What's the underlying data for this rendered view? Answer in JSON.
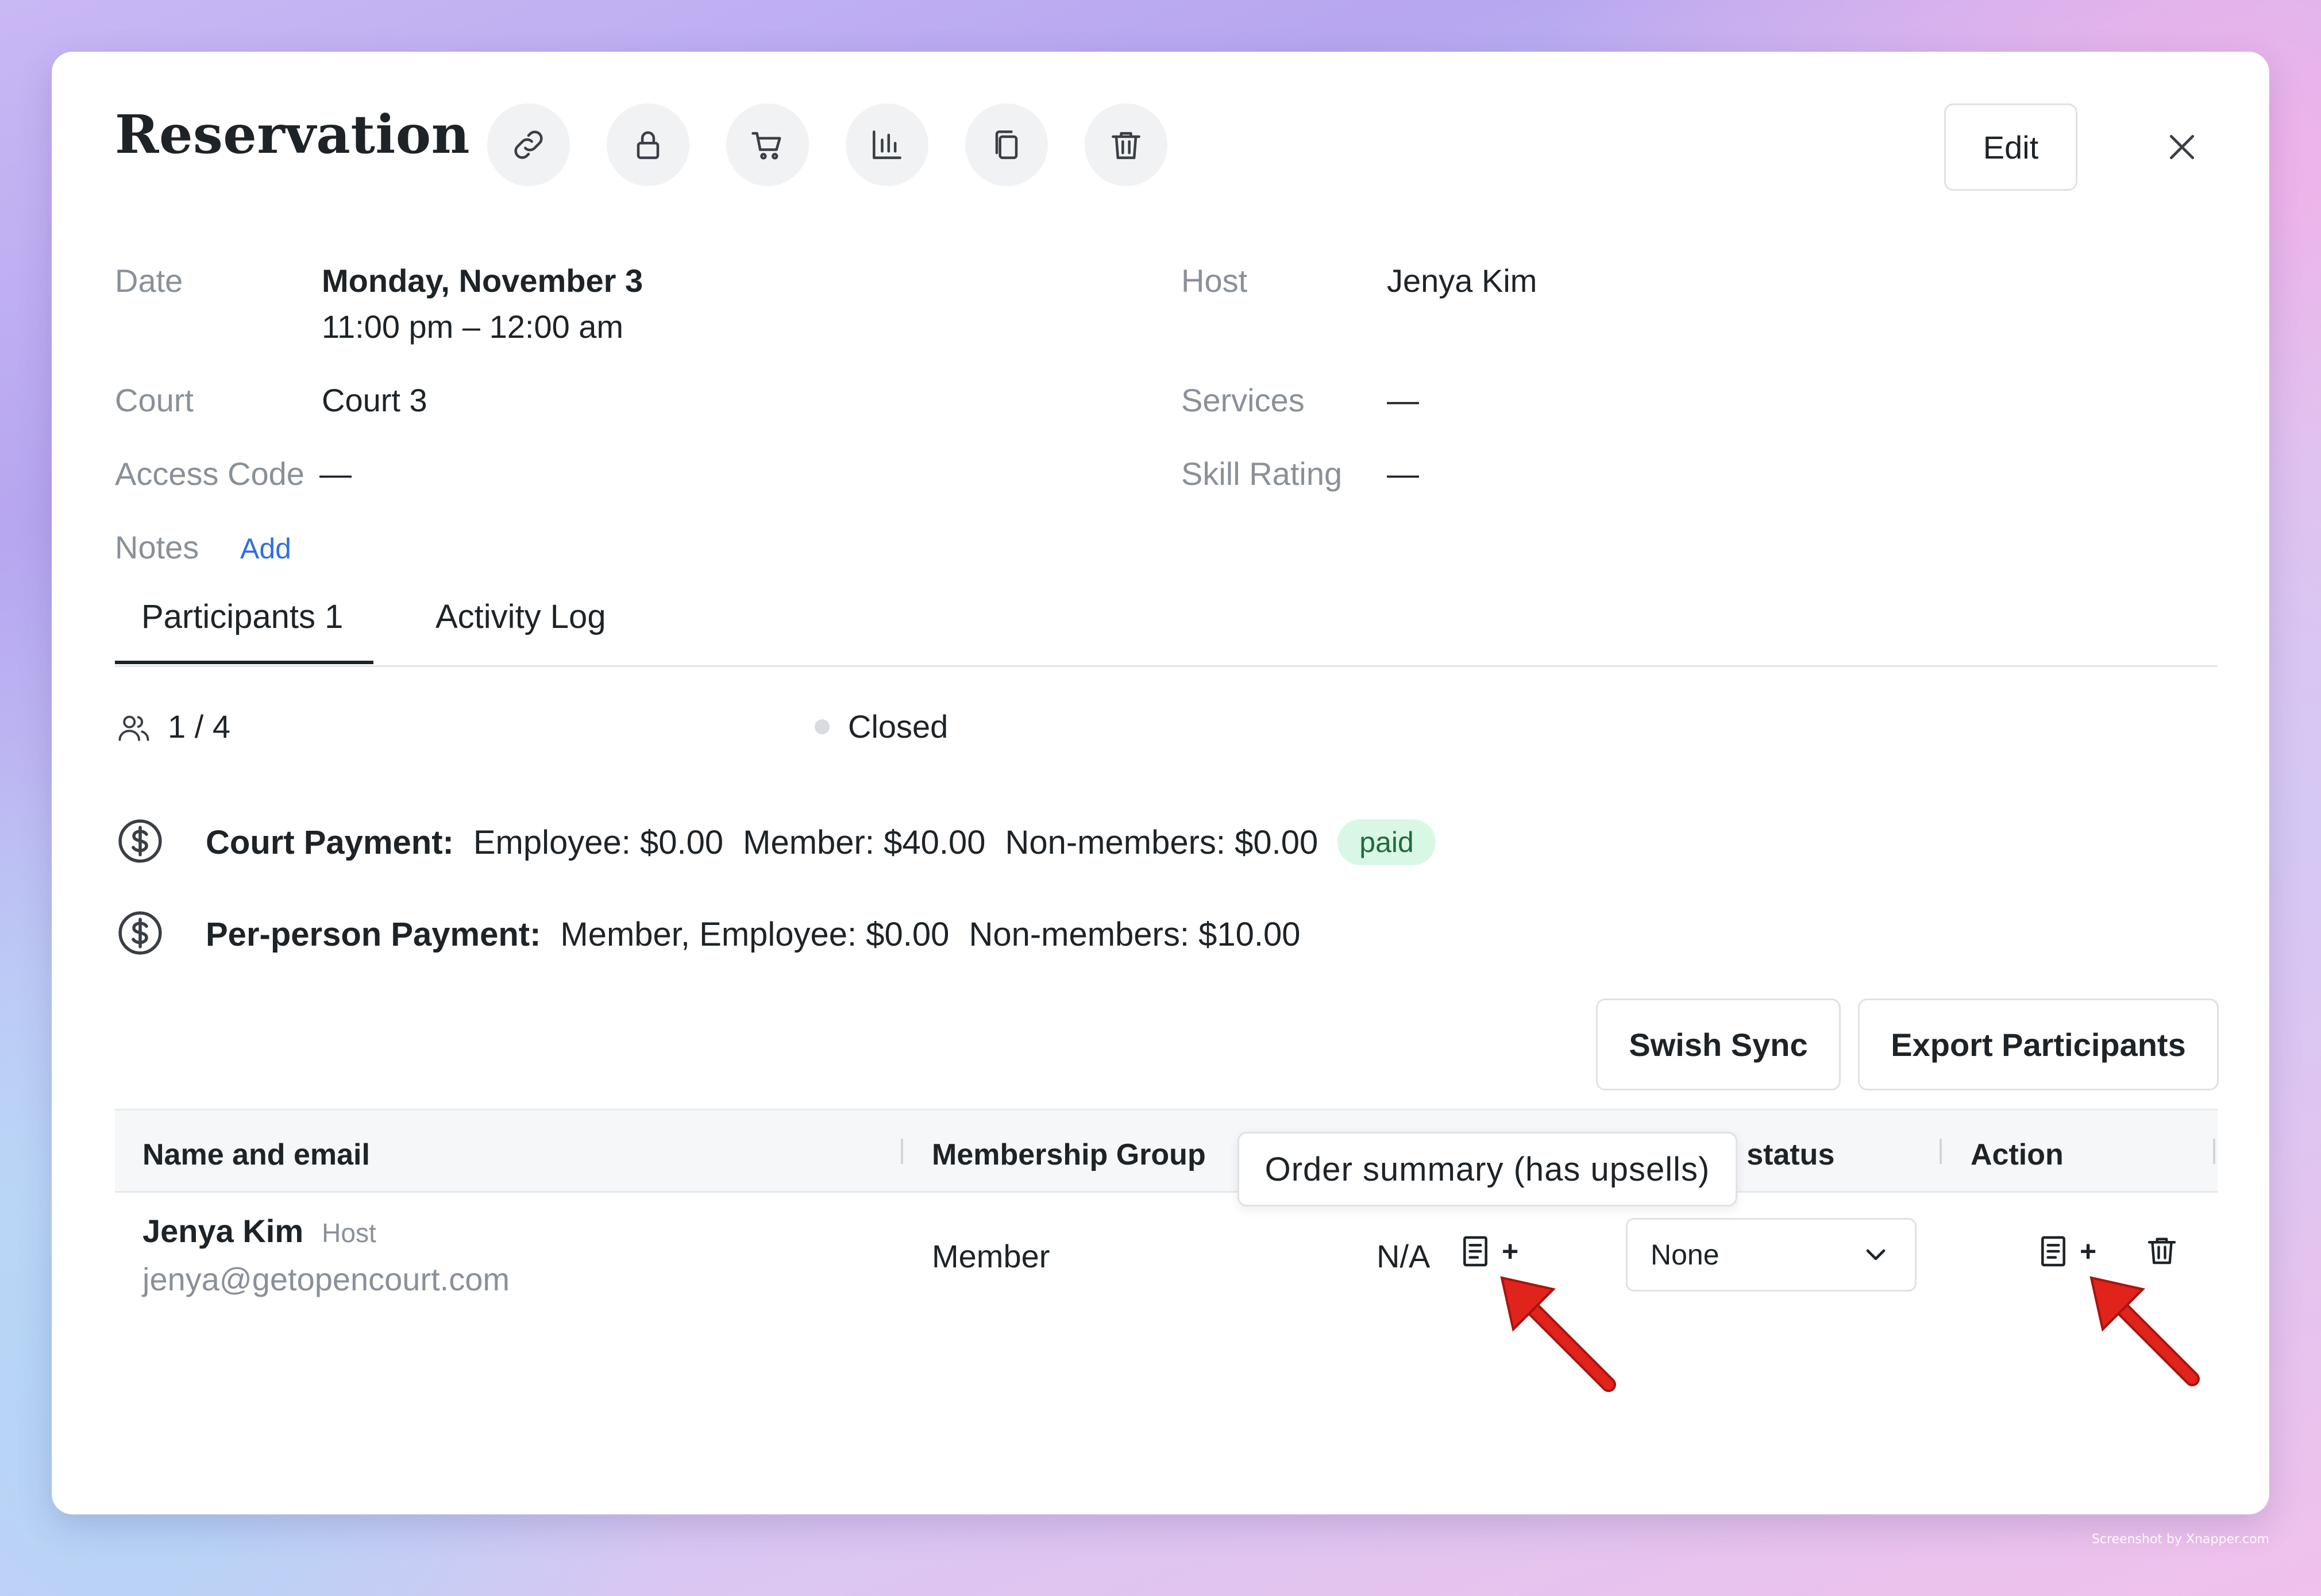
{
  "header": {
    "title": "Reservation",
    "icons": [
      "link-icon",
      "lock-icon",
      "cart-icon",
      "chart-icon",
      "copy-icon",
      "trash-icon"
    ],
    "edit_label": "Edit"
  },
  "details": {
    "date_label": "Date",
    "date_value": "Monday, November 3",
    "time_value": "11:00 pm – 12:00 am",
    "court_label": "Court",
    "court_value": "Court 3",
    "access_code_label": "Access Code",
    "access_code_value": "—",
    "notes_label": "Notes",
    "notes_add": "Add",
    "host_label": "Host",
    "host_value": "Jenya Kim",
    "services_label": "Services",
    "services_value": "—",
    "skill_label": "Skill Rating",
    "skill_value": "—"
  },
  "tabs": [
    {
      "label": "Participants 1",
      "active": true
    },
    {
      "label": "Activity Log",
      "active": false
    }
  ],
  "summary": {
    "count": "1 / 4",
    "status": "Closed"
  },
  "payments": {
    "court_label": "Court Payment:",
    "court_employee": "Employee: $0.00",
    "court_member": "Member: $40.00",
    "court_nonmember": "Non-members: $0.00",
    "court_badge": "paid",
    "per_person_label": "Per-person Payment:",
    "per_person_member": "Member, Employee: $0.00",
    "per_person_nonmember": "Non-members: $10.00"
  },
  "actions": {
    "swish_sync": "Swish Sync",
    "export": "Export Participants"
  },
  "table": {
    "headers": {
      "name": "Name and email",
      "membership": "Membership Group",
      "status_partial": "n status",
      "action": "Action"
    },
    "tooltip": "Order summary (has upsells)",
    "rows": [
      {
        "name": "Jenya Kim",
        "role": "Host",
        "email": "jenya@getopencourt.com",
        "membership": "Member",
        "payment": "N/A",
        "plus": "+",
        "status_select": "None",
        "action_plus": "+"
      }
    ]
  },
  "colors": {
    "accent_link": "#2f6fdf",
    "badge_bg": "#d9f7e5",
    "badge_text": "#1f6b3e",
    "annotation_arrow": "#e0231b"
  },
  "watermark": "Screenshot by Xnapper.com"
}
